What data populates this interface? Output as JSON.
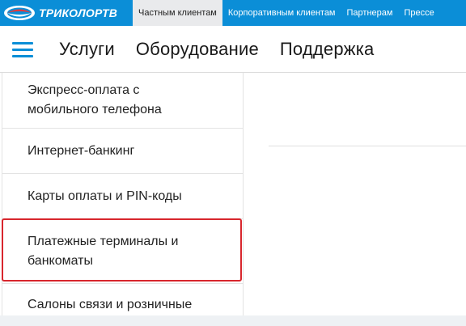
{
  "brand": {
    "logo_text": "ТРИКОЛОРТВ",
    "colors": {
      "primary": "#0b8ed7",
      "highlight": "#d8262d"
    }
  },
  "topnav": {
    "items": [
      {
        "label": "Частным клиентам",
        "active": true
      },
      {
        "label": "Корпоративным клиентам",
        "active": false
      },
      {
        "label": "Партнерам",
        "active": false
      },
      {
        "label": "Прессе",
        "active": false
      }
    ]
  },
  "mainnav": {
    "menu_icon": "hamburger-menu-icon",
    "items": [
      {
        "label": "Услуги"
      },
      {
        "label": "Оборудование"
      },
      {
        "label": "Поддержка"
      }
    ]
  },
  "sidebar": {
    "items": [
      {
        "label": "Экспресс-оплата с мобильного телефона"
      },
      {
        "label": "Интернет-банкинг"
      },
      {
        "label": "Карты оплаты и PIN-коды"
      },
      {
        "label": "Платежные терминалы и банкоматы",
        "highlighted": true
      },
      {
        "label": "Салоны связи и розничные"
      }
    ]
  }
}
